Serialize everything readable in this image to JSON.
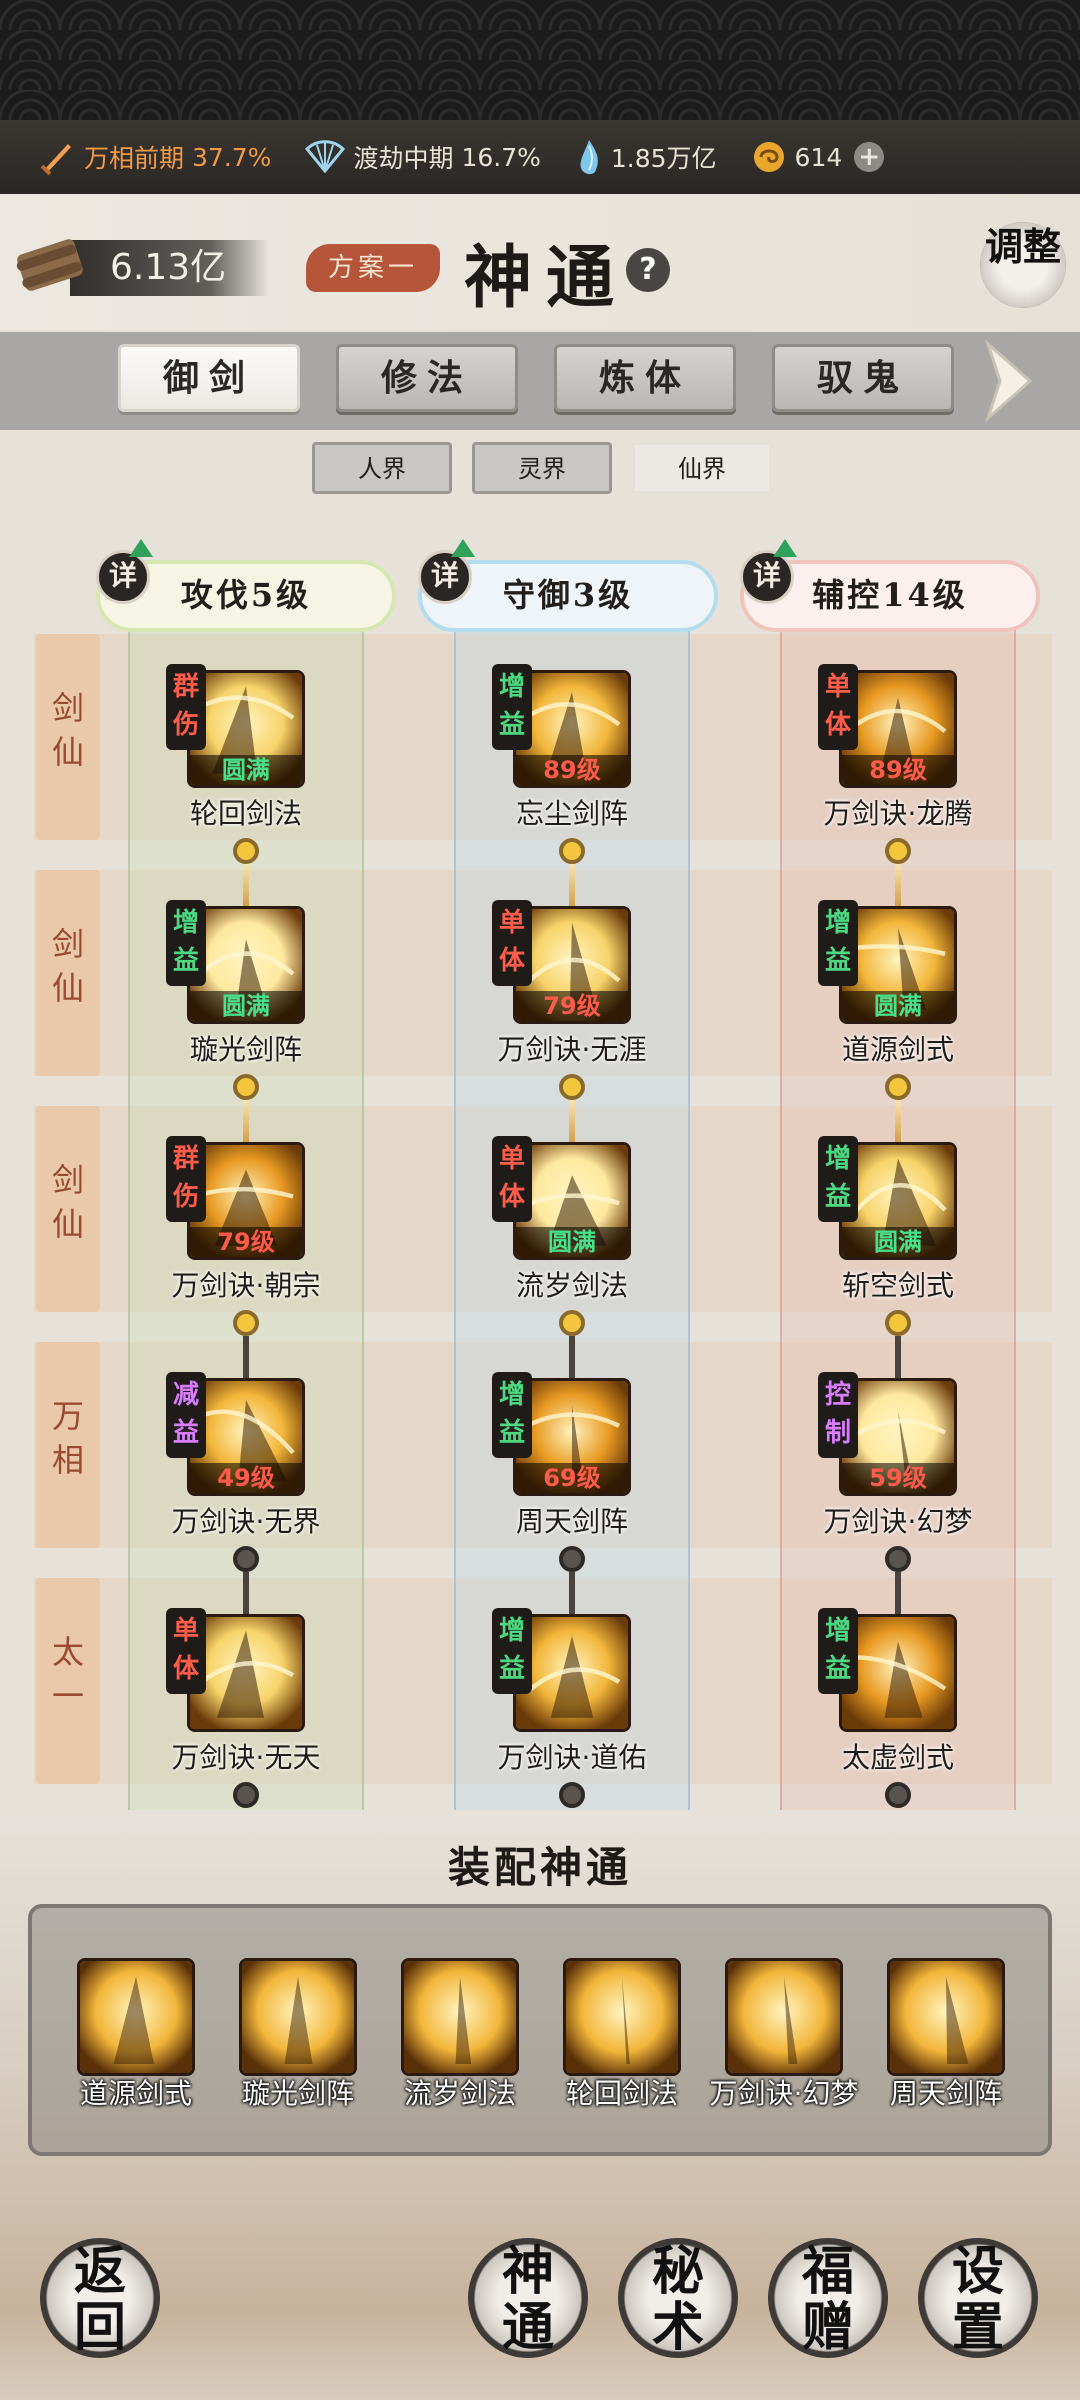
{
  "resources": [
    {
      "icon": "sword-icon",
      "label": "万相前期",
      "value": "37.7%",
      "color": "#f29a45"
    },
    {
      "icon": "fan-icon",
      "label": "渡劫中期",
      "value": "16.7%"
    },
    {
      "icon": "crystal-icon",
      "value": "1.85万亿"
    },
    {
      "icon": "coin-icon",
      "value": "614"
    }
  ],
  "header": {
    "power": "6.13亿",
    "plan": "方案一",
    "title": "神通",
    "help": "?",
    "adjust": "调整"
  },
  "categories": [
    "御剑",
    "修法",
    "炼体",
    "驭鬼"
  ],
  "selected_category": "御剑",
  "realms": [
    "人界",
    "灵界",
    "仙界"
  ],
  "selected_realm": "仙界",
  "columns": [
    {
      "detail": "详",
      "label": "攻伐5级"
    },
    {
      "detail": "详",
      "label": "守御3级"
    },
    {
      "detail": "详",
      "label": "辅控14级"
    }
  ],
  "rows": [
    {
      "tag": "剑仙",
      "skills": [
        {
          "type": "群伤",
          "level": "圆满",
          "name": "轮回剑法"
        },
        {
          "type": "增益",
          "level": "89级",
          "name": "忘尘剑阵"
        },
        {
          "type": "单体",
          "level": "89级",
          "name": "万剑诀·龙腾"
        }
      ]
    },
    {
      "tag": "剑仙",
      "skills": [
        {
          "type": "增益",
          "level": "圆满",
          "name": "璇光剑阵"
        },
        {
          "type": "单体",
          "level": "79级",
          "name": "万剑诀·无涯"
        },
        {
          "type": "增益",
          "level": "圆满",
          "name": "道源剑式"
        }
      ]
    },
    {
      "tag": "剑仙",
      "skills": [
        {
          "type": "群伤",
          "level": "79级",
          "name": "万剑诀·朝宗"
        },
        {
          "type": "单体",
          "level": "圆满",
          "name": "流岁剑法"
        },
        {
          "type": "增益",
          "level": "圆满",
          "name": "斩空剑式"
        }
      ]
    },
    {
      "tag": "万相",
      "skills": [
        {
          "type": "减益",
          "level": "49级",
          "name": "万剑诀·无界"
        },
        {
          "type": "增益",
          "level": "69级",
          "name": "周天剑阵"
        },
        {
          "type": "控制",
          "level": "59级",
          "name": "万剑诀·幻梦"
        }
      ]
    },
    {
      "tag": "太一",
      "skills": [
        {
          "type": "单体",
          "level": "",
          "name": "万剑诀·无天"
        },
        {
          "type": "增益",
          "level": "",
          "name": "万剑诀·道佑"
        },
        {
          "type": "增益",
          "level": "",
          "name": "太虚剑式"
        }
      ]
    }
  ],
  "equip": {
    "title": "装配神通",
    "items": [
      "道源剑式",
      "璇光剑阵",
      "流岁剑法",
      "轮回剑法",
      "万剑诀·幻梦",
      "周天剑阵"
    ]
  },
  "nav": {
    "back": "返回",
    "items": [
      "神通",
      "秘术",
      "福赠",
      "设置"
    ]
  }
}
